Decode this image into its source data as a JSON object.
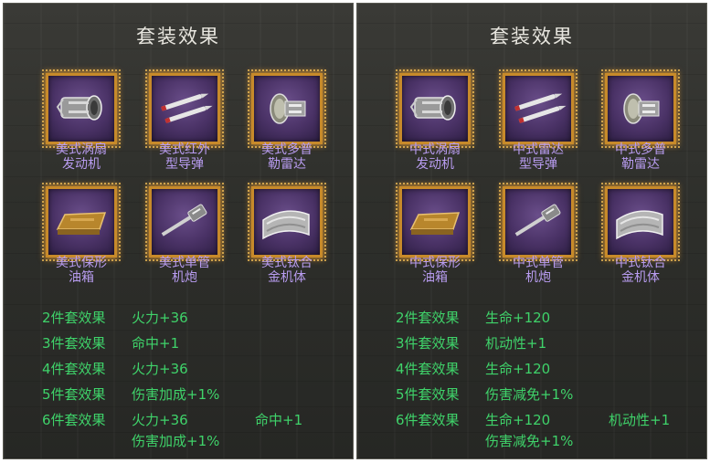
{
  "colors": {
    "label_purple": "#b89cf0",
    "bonus_green": "#3fd36a",
    "frame_gold": "#c78a2a",
    "slot_purple": "#4a3266"
  },
  "panels": [
    {
      "title": "套装效果",
      "items": [
        {
          "icon": "turbofan-engine-icon",
          "line1": "美式涡扇",
          "line2": "发动机"
        },
        {
          "icon": "missile-icon",
          "line1": "美式红外",
          "line2": "型导弹"
        },
        {
          "icon": "radar-icon",
          "line1": "美式多普",
          "line2": "勒雷达"
        },
        {
          "icon": "fuel-tank-icon",
          "line1": "美式保形",
          "line2": "油箱"
        },
        {
          "icon": "cannon-icon",
          "line1": "美式单管",
          "line2": "机炮"
        },
        {
          "icon": "titanium-body-icon",
          "line1": "美式钛合",
          "line2": "金机体"
        }
      ],
      "bonuses": [
        {
          "count": "2件套效果",
          "effect": "火力+36"
        },
        {
          "count": "3件套效果",
          "effect": "命中+1"
        },
        {
          "count": "4件套效果",
          "effect": "火力+36"
        },
        {
          "count": "5件套效果",
          "effect": "伤害加成+1%"
        },
        {
          "count": "6件套效果",
          "effect": "火力+36",
          "effect2": "伤害加成+1%",
          "effect3": "命中+1"
        }
      ]
    },
    {
      "title": "套装效果",
      "items": [
        {
          "icon": "turbofan-engine-icon",
          "line1": "中式涡扇",
          "line2": "发动机"
        },
        {
          "icon": "missile-icon",
          "line1": "中式雷达",
          "line2": "型导弹"
        },
        {
          "icon": "radar-icon",
          "line1": "中式多普",
          "line2": "勒雷达"
        },
        {
          "icon": "fuel-tank-icon",
          "line1": "中式保形",
          "line2": "油箱"
        },
        {
          "icon": "cannon-icon",
          "line1": "中式单管",
          "line2": "机炮"
        },
        {
          "icon": "titanium-body-icon",
          "line1": "中式钛合",
          "line2": "金机体"
        }
      ],
      "bonuses": [
        {
          "count": "2件套效果",
          "effect": "生命+120"
        },
        {
          "count": "3件套效果",
          "effect": "机动性+1"
        },
        {
          "count": "4件套效果",
          "effect": "生命+120"
        },
        {
          "count": "5件套效果",
          "effect": "伤害减免+1%"
        },
        {
          "count": "6件套效果",
          "effect": "生命+120",
          "effect2": "伤害减免+1%",
          "effect3": "机动性+1"
        }
      ]
    }
  ]
}
